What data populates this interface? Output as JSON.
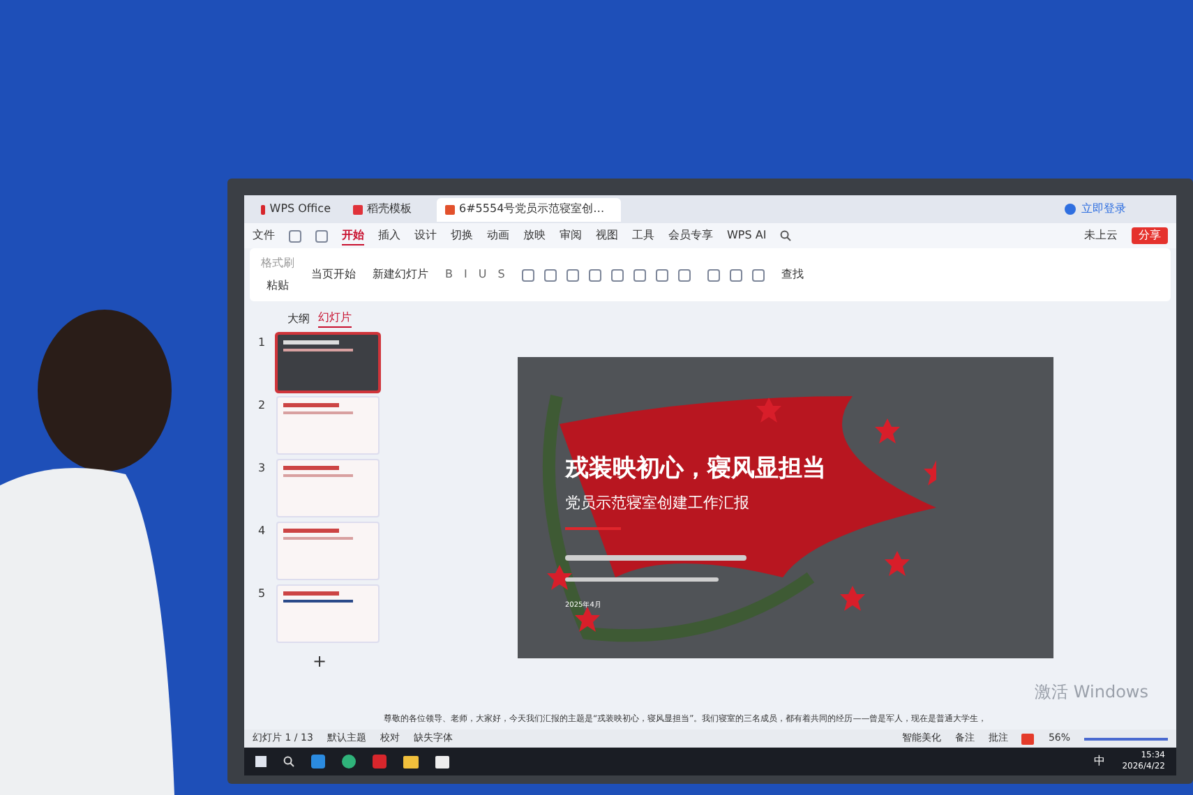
{
  "window_tabs": [
    {
      "label": "WPS Office",
      "kind": "home",
      "selected": false
    },
    {
      "label": "稻壳模板",
      "kind": "template",
      "selected": false
    },
    {
      "label": "6#5554号党员示范寝室创…",
      "kind": "doc",
      "selected": true
    }
  ],
  "account": {
    "login": "立即登录"
  },
  "menu": {
    "file": "文件",
    "tabs": [
      {
        "label": "开始",
        "selected": true
      },
      {
        "label": "插入",
        "selected": false
      },
      {
        "label": "设计",
        "selected": false
      },
      {
        "label": "切换",
        "selected": false
      },
      {
        "label": "动画",
        "selected": false
      },
      {
        "label": "放映",
        "selected": false
      },
      {
        "label": "审阅",
        "selected": false
      },
      {
        "label": "视图",
        "selected": false
      },
      {
        "label": "工具",
        "selected": false
      },
      {
        "label": "会员专享",
        "selected": false
      }
    ],
    "ai": "WPS AI",
    "cloud": "未上云",
    "share": "分享"
  },
  "ribbon": {
    "format_painter": "格式刷",
    "paste": "粘贴",
    "play": "当页开始",
    "new_slide": "新建幻灯片",
    "find": "查找",
    "font_buttons": [
      "B",
      "I",
      "U",
      "S"
    ]
  },
  "panel": {
    "tabs": [
      {
        "label": "大纲",
        "selected": false
      },
      {
        "label": "幻灯片",
        "selected": true
      }
    ],
    "slides": [
      {
        "number": "1",
        "kind": "cover",
        "selected": true
      },
      {
        "number": "2",
        "kind": "three",
        "selected": false
      },
      {
        "number": "3",
        "kind": "list",
        "selected": false
      },
      {
        "number": "4",
        "kind": "three",
        "selected": false
      },
      {
        "number": "5",
        "kind": "bar",
        "selected": false
      }
    ],
    "add": "+"
  },
  "slide": {
    "title": "戎装映初心，寝风显担当",
    "subtitle": "党员示范寝室创建工作汇报",
    "date": "2025年4月"
  },
  "notes": {
    "text": "尊敬的各位领导、老师，大家好，今天我们汇报的主题是“戎装映初心，寝风显担当”。我们寝室的三名成员，都有着共同的经历——曾是军人，现在是普通大学生，"
  },
  "activation": {
    "title": "激活 Windows"
  },
  "status_bar": {
    "slide_count": "幻灯片 1 / 13",
    "theme": "默认主题",
    "proofread": "校对",
    "missing_font": "缺失字体",
    "beautify": "智能美化",
    "notes": "备注",
    "comment": "批注",
    "zoom": "56%"
  },
  "taskbar": {
    "time": "15:34",
    "date": "2026/4/22",
    "ime": "中"
  }
}
